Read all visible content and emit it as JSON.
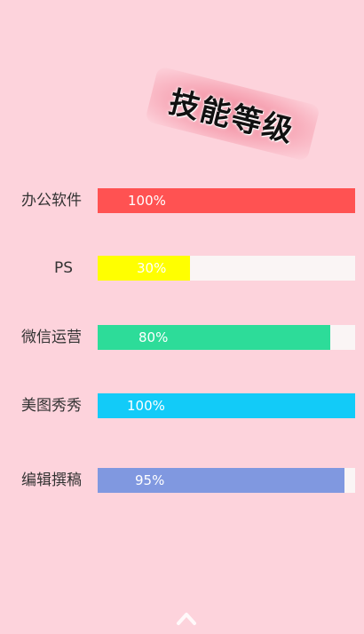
{
  "title": "技能等级",
  "skills": [
    {
      "label": "办公软件",
      "percent_text": "100%",
      "level": 1.0,
      "color": "#ff5252"
    },
    {
      "label": "PS",
      "percent_text": "30%",
      "level": 0.36,
      "color": "#ffff00"
    },
    {
      "label": "微信运营",
      "percent_text": "80%",
      "level": 0.905,
      "color": "#2ddc99"
    },
    {
      "label": "美图秀秀",
      "percent_text": "100%",
      "level": 1.0,
      "color": "#12cbf8"
    },
    {
      "label": "编辑撰稿",
      "percent_text": "95%",
      "level": 0.96,
      "color": "#8098e0"
    }
  ],
  "icons": {
    "back_to_top": "chevron-up-icon"
  },
  "colors": {
    "background": "#fdd3dc",
    "track": "#faf5f5"
  }
}
